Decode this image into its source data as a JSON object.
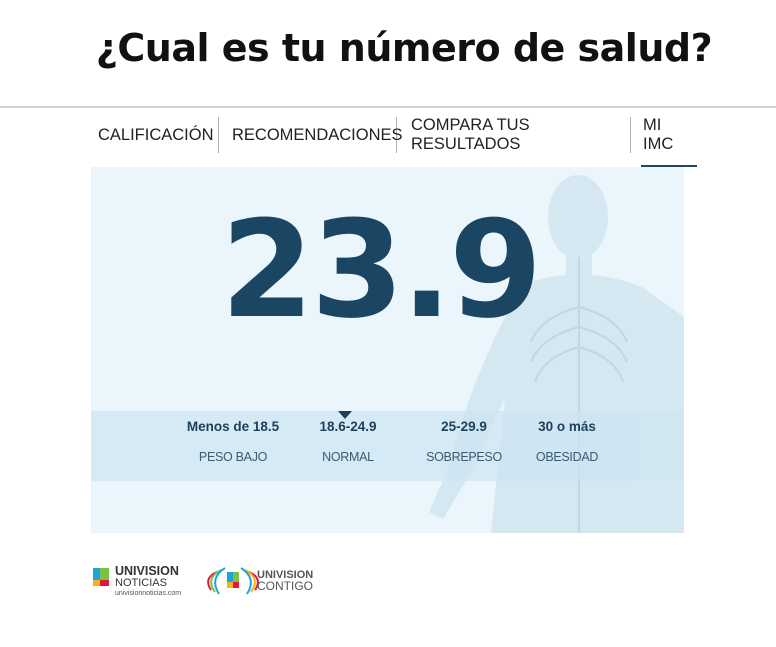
{
  "page": {
    "title": "¿Cual es tu número de salud?"
  },
  "tabs": [
    {
      "label": "CALIFICACIÓN",
      "active": false
    },
    {
      "label": "RECOMENDACIONES",
      "active": false
    },
    {
      "label": "COMPARA TUS RESULTADOS",
      "active": false
    },
    {
      "label": "MI IMC",
      "active": true
    }
  ],
  "result": {
    "bmi_value": "23.9",
    "current_category_index": 1
  },
  "scale": [
    {
      "range": "Menos de 18.5",
      "category": "PESO BAJO"
    },
    {
      "range": "18.6-24.9",
      "category": "NORMAL"
    },
    {
      "range": "25-29.9",
      "category": "SOBREPESO"
    },
    {
      "range": "30 o más",
      "category": "OBESIDAD"
    }
  ],
  "footer": {
    "logo1": {
      "line1": "UNIVISION",
      "line2": "NOTICIAS",
      "line3": "univisionnoticias.com"
    },
    "logo2": {
      "line1": "UNIVISION",
      "line2": "CONTIGO"
    }
  },
  "colors": {
    "accent": "#1a4563",
    "panel_bg": "#eaf6fc",
    "band_bg": "#d0e6f2"
  }
}
